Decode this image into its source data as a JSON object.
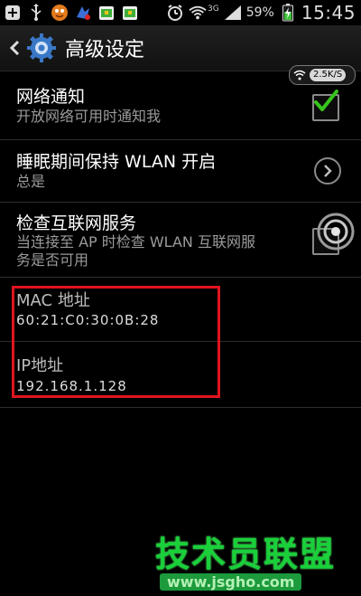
{
  "status_bar": {
    "battery": "59%",
    "time": "15:45",
    "network_type": "3G",
    "icons": [
      "add-icon",
      "usb-icon",
      "android-app-icon",
      "notification-app-icon",
      "store-icon",
      "store-icon",
      "alarm-icon",
      "wifi-icon",
      "signal-icon",
      "battery-icon"
    ]
  },
  "action_bar": {
    "title": "高级设定",
    "app_icon": "gear-icon"
  },
  "speed_badge": {
    "rate": "2.5K/S",
    "icon": "wifi-icon"
  },
  "settings": [
    {
      "title": "网络通知",
      "subtitle": "开放网络可用时通知我",
      "control": "checkbox",
      "checked": true
    },
    {
      "title": "睡眠期间保持 WLAN 开启",
      "subtitle": "总是",
      "control": "chevron"
    },
    {
      "title": "检查互联网服务",
      "subtitle_line1": "当连接至 AP 时检查 WLAN 互联网服",
      "subtitle_line2": "务是否可用",
      "control": "checkbox",
      "checked": false
    }
  ],
  "info": {
    "mac_label": "MAC 地址",
    "mac_value": "60:21:C0:30:0B:28",
    "ip_label": "IP地址",
    "ip_value": "192.168.1.128"
  },
  "watermark": {
    "text": "技术员联盟",
    "url": "www.jsgho.com"
  },
  "colors": {
    "accent_check": "#36c51c",
    "highlight": "#e0141f",
    "watermark": "#19d03a"
  }
}
